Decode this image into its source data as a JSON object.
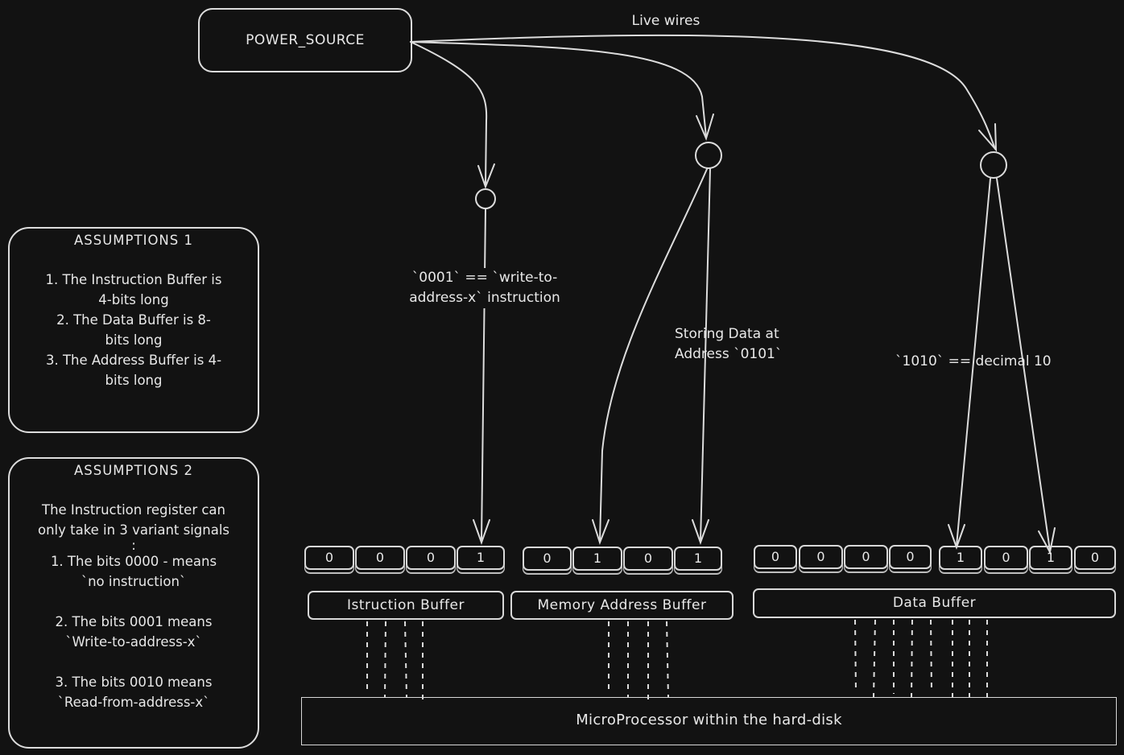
{
  "power_source": {
    "label": "POWER_SOURCE"
  },
  "live_wires_label": "Live wires",
  "annotations": {
    "instruction_signal": [
      "`0001` == `write-to-",
      "address-x` instruction"
    ],
    "address_signal": [
      "Storing Data at",
      "Address `0101`"
    ],
    "data_signal": "`1010` == decimal 10"
  },
  "assumptions_1": {
    "title": "ASSUMPTIONS 1",
    "lines": [
      "1. The Instruction Buffer is",
      "4-bits long",
      "2. The Data Buffer is 8-",
      "bits long",
      "3. The Address Buffer is 4-",
      "bits long"
    ]
  },
  "assumptions_2": {
    "title": "ASSUMPTIONS 2",
    "intro": [
      "The Instruction register can",
      "only take in 3 variant signals",
      ":"
    ],
    "items": [
      [
        "1. The bits 0000 - means",
        "`no instruction`"
      ],
      [
        "2. The bits 0001 means",
        "`Write-to-address-x`"
      ],
      [
        "3. The bits 0010 means",
        "`Read-from-address-x`"
      ]
    ]
  },
  "buffers": {
    "instruction": {
      "label": "Istruction Buffer",
      "bits": [
        "0",
        "0",
        "0",
        "1"
      ]
    },
    "address": {
      "label": "Memory Address Buffer",
      "bits": [
        "0",
        "1",
        "0",
        "1"
      ]
    },
    "data": {
      "label": "Data Buffer",
      "bits_high": [
        "0",
        "0",
        "0",
        "0"
      ],
      "bits_low": [
        "1",
        "0",
        "1",
        "0"
      ]
    }
  },
  "microprocessor": {
    "label": "MicroProcessor within the hard-disk"
  }
}
